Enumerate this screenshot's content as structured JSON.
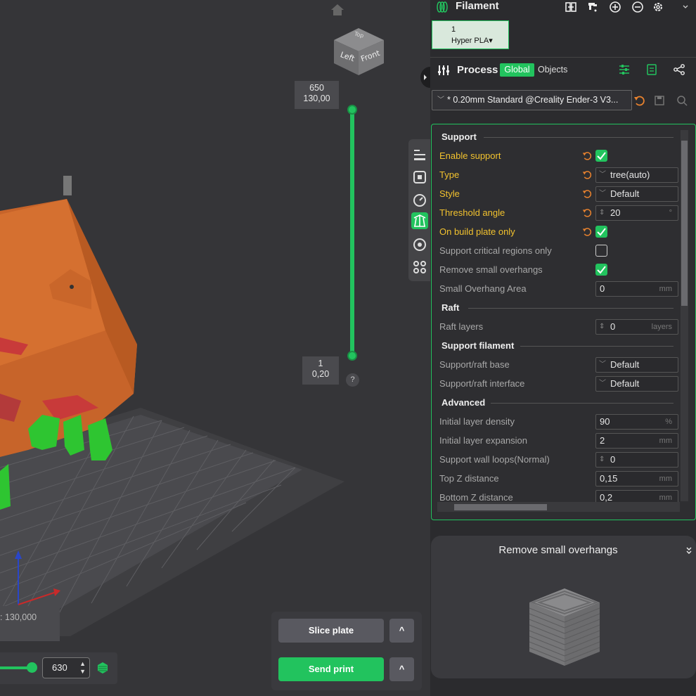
{
  "viewport": {
    "navcube": {
      "left": "Left",
      "front": "Front",
      "top": "Top"
    },
    "layer_top": {
      "layer": "650",
      "height": "130,00"
    },
    "layer_bottom": {
      "layer": "1",
      "height": "0,20"
    },
    "help_mark": "?",
    "coord_text": ": 130,000",
    "layer_spin_value": "630",
    "spin_arrows": "▲▼",
    "slice_button": "Slice plate",
    "send_button": "Send print",
    "caret": "^"
  },
  "filament": {
    "title": "Filament",
    "slot_number": "1",
    "slot_name": "Hyper PLA",
    "caret": "▾"
  },
  "process": {
    "title": "Process",
    "tab_global": "Global",
    "tab_objects": "Objects",
    "preset": "* 0.20mm Standard @Creality Ender-3 V3..."
  },
  "settings": {
    "support": {
      "title": "Support",
      "enable_support": "Enable support",
      "type_label": "Type",
      "type_value": "tree(auto)",
      "style_label": "Style",
      "style_value": "Default",
      "threshold_label": "Threshold angle",
      "threshold_value": "20",
      "threshold_unit": "°",
      "build_plate_only": "On build plate only",
      "critical_regions": "Support critical regions only",
      "remove_small_overhangs": "Remove small overhangs",
      "small_overhang_area_label": "Small Overhang Area",
      "small_overhang_area_value": "0",
      "small_overhang_area_unit": "mm"
    },
    "raft": {
      "title": "Raft",
      "raft_layers_label": "Raft layers",
      "raft_layers_value": "0",
      "raft_layers_unit": "layers"
    },
    "support_filament": {
      "title": "Support filament",
      "base_label": "Support/raft base",
      "base_value": "Default",
      "interface_label": "Support/raft interface",
      "interface_value": "Default"
    },
    "advanced": {
      "title": "Advanced",
      "initial_density_label": "Initial layer density",
      "initial_density_value": "90",
      "initial_density_unit": "%",
      "initial_expansion_label": "Initial layer expansion",
      "initial_expansion_value": "2",
      "initial_expansion_unit": "mm",
      "wall_loops_label": "Support wall loops(Normal)",
      "wall_loops_value": "0",
      "top_z_label": "Top Z distance",
      "top_z_value": "0,15",
      "top_z_unit": "mm",
      "bottom_z_label": "Bottom Z distance",
      "bottom_z_value": "0,2",
      "bottom_z_unit": "mm"
    }
  },
  "help": {
    "title": "Remove small overhangs"
  },
  "colors": {
    "accent": "#22c35e",
    "modified": "#f2c22e",
    "undo": "#e8822e",
    "model_orange": "#d2692a"
  }
}
